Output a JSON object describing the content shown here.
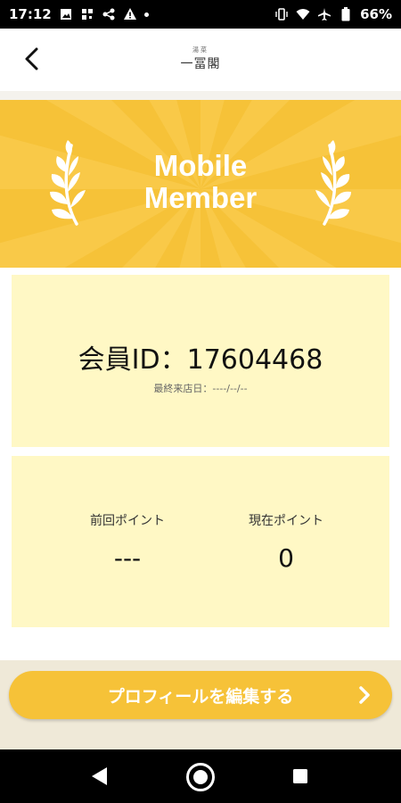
{
  "status_bar": {
    "time": "17:12",
    "battery": "66%"
  },
  "header": {
    "logo_small": "湯菜",
    "logo_main": "一冨閣"
  },
  "banner": {
    "title_line1": "Mobile",
    "title_line2": "Member",
    "background_color": "#f6c238",
    "ray_color": "#fbd055"
  },
  "member": {
    "id_text": "会員ID：17604468",
    "last_visit_label": "最終来店日：----/--/--"
  },
  "points": {
    "previous_label": "前回ポイント",
    "previous_value": "---",
    "current_label": "現在ポイント",
    "current_value": "0"
  },
  "actions": {
    "edit_profile_label": "プロフィールを編集する"
  },
  "colors": {
    "accent": "#f6c238",
    "card": "#fff8c5"
  }
}
